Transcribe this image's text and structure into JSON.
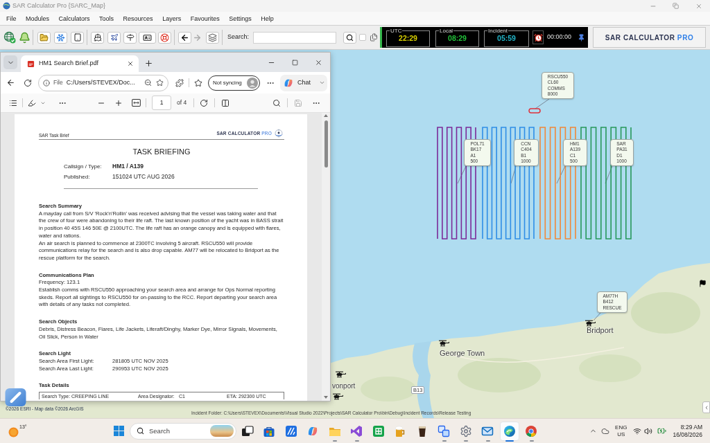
{
  "app": {
    "title": "SAR Calculator Pro {SARC_Map}"
  },
  "menu": [
    "File",
    "Modules",
    "Calculators",
    "Tools",
    "Resources",
    "Layers",
    "Favourites",
    "Settings",
    "Help"
  ],
  "toolbar": {
    "search_label": "Search:",
    "option_checked": false,
    "forward_disabled": true
  },
  "clocks": [
    {
      "label": "UTC",
      "time": "22:29",
      "color": "#d8d000"
    },
    {
      "label": "Local",
      "time": "08:29",
      "color": "#22c03a"
    },
    {
      "label": "Incident",
      "time": "05:59",
      "color": "#22b5c8"
    }
  ],
  "timer": "00:00:00",
  "logo": {
    "text": "SAR CALCULATOR",
    "accent": "PRO"
  },
  "map": {
    "assets": [
      {
        "kind": "orbit",
        "color": "#e0303a",
        "callout": [
          "RSCU550",
          "CL60",
          "COMMS",
          "8000"
        ]
      },
      {
        "kind": "track",
        "color": "#7b2a98",
        "callout": [
          "POL71",
          "BK17",
          "A1",
          "500"
        ]
      },
      {
        "kind": "track",
        "color": "#2f8ee6",
        "callout": [
          "CCN",
          "C404",
          "B1",
          "1000"
        ]
      },
      {
        "kind": "track",
        "color": "#f0883a",
        "callout": [
          "HM1",
          "A139",
          "C1",
          "500"
        ]
      },
      {
        "kind": "track",
        "color": "#27985a",
        "callout": [
          "SAR",
          "PA31",
          "D1",
          "1000"
        ]
      },
      {
        "kind": "helicopter",
        "callout": [
          "AM77H",
          "B412",
          "RESCUE"
        ]
      }
    ],
    "places": [
      "Bridport",
      "George Town",
      "vonport"
    ],
    "road_label": "B13",
    "attribution": "©2026 ESRI - Map data ©2026 ArcGIS",
    "status": "Incident Folder: C:\\Users\\STEVEX\\Documents\\Visual Studio 2022\\Projects\\SAR Calculator Pro\\bin\\Debug\\Incident Records\\Release Testing"
  },
  "pdf_viewer": {
    "tabs": [
      {
        "title": "HM1 Search Brief.pdf",
        "selected": true
      }
    ],
    "address": {
      "scheme": "File",
      "url": "C:/Users/STEVEX/Doc..."
    },
    "profile": "Not syncing",
    "chat": "Chat",
    "page_number": "1",
    "page_count": "of 4",
    "save_disabled": true,
    "document": {
      "header": "SAR Task Brief",
      "brand": {
        "text": "SAR CALCULATOR",
        "accent": "PRO"
      },
      "title": "TASK BRIEFING",
      "callsign": {
        "label": "Callsign / Type:",
        "value": "HM1 / A139"
      },
      "published": {
        "label": "Published:",
        "value": "151024 UTC AUG 2026"
      },
      "sections": [
        {
          "kind": "text",
          "heading": "Search Summary",
          "paragraphs": [
            "A mayday call from S/V 'Rock'n'Rollin' was received advising that the vessel was taking water and that the crew of four were abandoning to their life raft. The last known position of the yacht was in BASS strait in position 40 45S 146 50E @ 2100UTC. The life raft has an orange canopy and is equipped with flares, water and rations.",
            "An air search is planned to commence at 2300TC involving 5 aircraft. RSCU550 will provide communications relay for the search and is also drop capable. AM77 will be relocated to Bridport as the rescue platform for the search."
          ]
        },
        {
          "kind": "text",
          "heading": "Communications Plan",
          "paragraphs": [
            "Frequency: 123.1",
            "Establish comms with RSCU550 approaching your search area and arrange for Ops Normal reporting skeds. Report all sightings to RSCU550 for on-passing to the RCC. Report departing your search area with details of any tasks not completed."
          ]
        },
        {
          "kind": "text",
          "heading": "Search Objects",
          "paragraphs": [
            "Debris, Distress Beacon, Flares, Life Jackets, Liferaft/Dinghy, Marker Dye, Mirror Signals, Movements, Oil Slick, Person in Water"
          ]
        },
        {
          "kind": "rows",
          "heading": "Search Light",
          "rows": [
            {
              "label": "Search Area First Light:",
              "value": "281805 UTC NOV 2025"
            },
            {
              "label": "Search Area Last Light:",
              "value": "290953 UTC NOV 2025"
            }
          ]
        },
        {
          "kind": "table",
          "heading": "Task Details",
          "cells": [
            "Search Type: CREEPING LINE",
            "Area Designator:",
            "C1",
            "ETA: 292300 UTC"
          ]
        }
      ]
    }
  },
  "taskbar": {
    "temperature": "13°",
    "search_placeholder": "Search",
    "apps": [
      {
        "running": false,
        "selected": false
      },
      {
        "running": false,
        "selected": false
      },
      {
        "running": false,
        "selected": false
      },
      {
        "running": false,
        "selected": false
      },
      {
        "running": true,
        "selected": false
      },
      {
        "running": true,
        "selected": false
      },
      {
        "running": false,
        "selected": false
      },
      {
        "running": false,
        "selected": false
      },
      {
        "running": false,
        "selected": false
      },
      {
        "running": true,
        "selected": false
      },
      {
        "running": true,
        "selected": false
      },
      {
        "running": true,
        "selected": false
      },
      {
        "running": true,
        "selected": true
      },
      {
        "running": true,
        "selected": false
      }
    ],
    "language": "ENG",
    "region": "US",
    "time": "8:29 AM",
    "date": "16/08/2026"
  }
}
